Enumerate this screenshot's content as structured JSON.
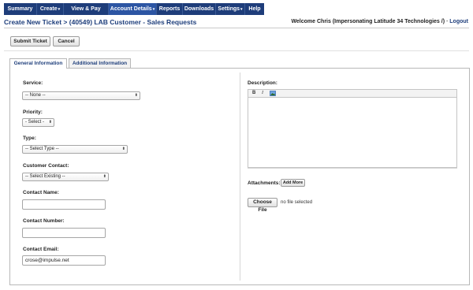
{
  "nav": {
    "items": [
      {
        "label": "Summary",
        "dropdown": false
      },
      {
        "label": "Create",
        "dropdown": true
      },
      {
        "label": "View & Pay Bills",
        "dropdown": true
      },
      {
        "label": "Account Details",
        "dropdown": true
      },
      {
        "label": "Reports",
        "dropdown": false
      },
      {
        "label": "Downloads",
        "dropdown": false
      },
      {
        "label": "Settings",
        "dropdown": true
      },
      {
        "label": "Help",
        "dropdown": false
      }
    ],
    "caret": "▾"
  },
  "page": {
    "title": "Create New Ticket > (40549) LAB Customer - Sales Requests",
    "welcome_prefix": "Welcome Chris (Impersonating Latitude 34 Technologies /)",
    "welcome_sep": " - ",
    "logout": "Logout"
  },
  "toolbar": {
    "submit_label": "Submit Ticket",
    "cancel_label": "Cancel"
  },
  "tabs": [
    {
      "label": "General Information",
      "active": true
    },
    {
      "label": "Additional Information",
      "active": false
    }
  ],
  "form": {
    "service": {
      "label": "Service:",
      "value": "-- None --"
    },
    "priority": {
      "label": "Priority:",
      "value": "- Select -"
    },
    "type": {
      "label": "Type:",
      "value": "-- Select Type --"
    },
    "customer_contact": {
      "label": "Customer Contact:",
      "value": "-- Select Existing --"
    },
    "contact_name": {
      "label": "Contact Name:",
      "value": ""
    },
    "contact_number": {
      "label": "Contact Number:",
      "value": ""
    },
    "contact_email": {
      "label": "Contact Email:",
      "value": "crose@impulse.net"
    }
  },
  "description": {
    "label": "Description:",
    "bold_btn": "B",
    "italic_btn": "I"
  },
  "attachments": {
    "label": "Attachments:",
    "add_more_label": "Add More",
    "choose_file_label": "Choose File",
    "no_file_text": "no file selected"
  },
  "colors": {
    "nav_bg": "#1e3d7a",
    "nav_active": "#2c55a3",
    "title": "#1f3f7c"
  },
  "icons": {
    "select_arrow": "⬍",
    "image_icon": "image-icon"
  }
}
